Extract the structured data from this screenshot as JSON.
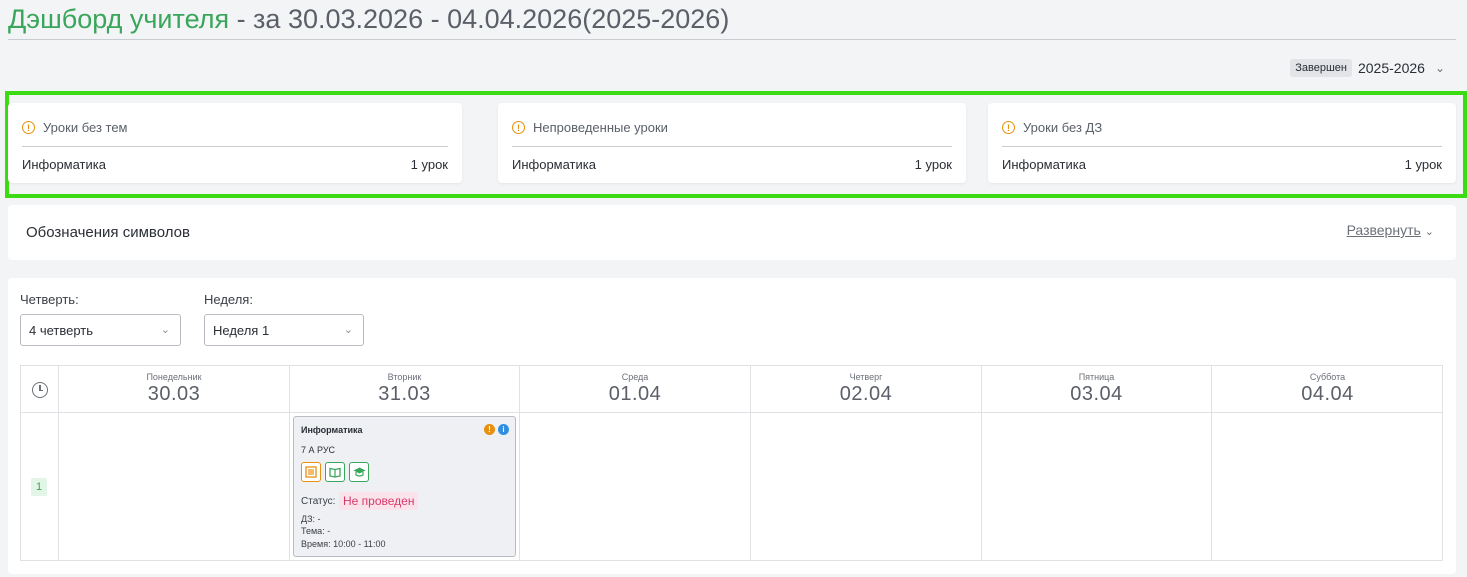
{
  "header": {
    "title": "Дэшборд учителя",
    "subtitle": " - за 30.03.2026 - 04.04.2026(2025-2026)"
  },
  "year_selector": {
    "badge": "Завершен",
    "value": "2025-2026"
  },
  "stats": [
    {
      "title": "Уроки без тем",
      "subject": "Информатика",
      "count": "1 урок"
    },
    {
      "title": "Непроведенные уроки",
      "subject": "Информатика",
      "count": "1 урок"
    },
    {
      "title": "Уроки без ДЗ",
      "subject": "Информатика",
      "count": "1 урок"
    }
  ],
  "legend": {
    "title": "Обозначения символов",
    "expand": "Развернуть"
  },
  "filters": {
    "quarter_label": "Четверть:",
    "quarter_value": "4 четверть",
    "week_label": "Неделя:",
    "week_value": "Неделя 1"
  },
  "days": [
    {
      "name": "Понедельник",
      "date": "30.03"
    },
    {
      "name": "Вторник",
      "date": "31.03"
    },
    {
      "name": "Среда",
      "date": "01.04"
    },
    {
      "name": "Четверг",
      "date": "02.04"
    },
    {
      "name": "Пятница",
      "date": "03.04"
    },
    {
      "name": "Суббота",
      "date": "04.04"
    }
  ],
  "lesson_number": "1",
  "lesson": {
    "subject": "Информатика",
    "class": "7 А РУС",
    "status_label": "Статус:",
    "status": "Не проведен",
    "hw": "ДЗ: -",
    "topic": "Тема: -",
    "time": "Время: 10:00 - 11:00"
  },
  "colors": {
    "accent_green": "#3aa65b",
    "warning_orange": "#e8900f",
    "info_blue": "#2f8fe0",
    "status_pink": "#d63a6a",
    "highlight": "#3bdc14"
  }
}
